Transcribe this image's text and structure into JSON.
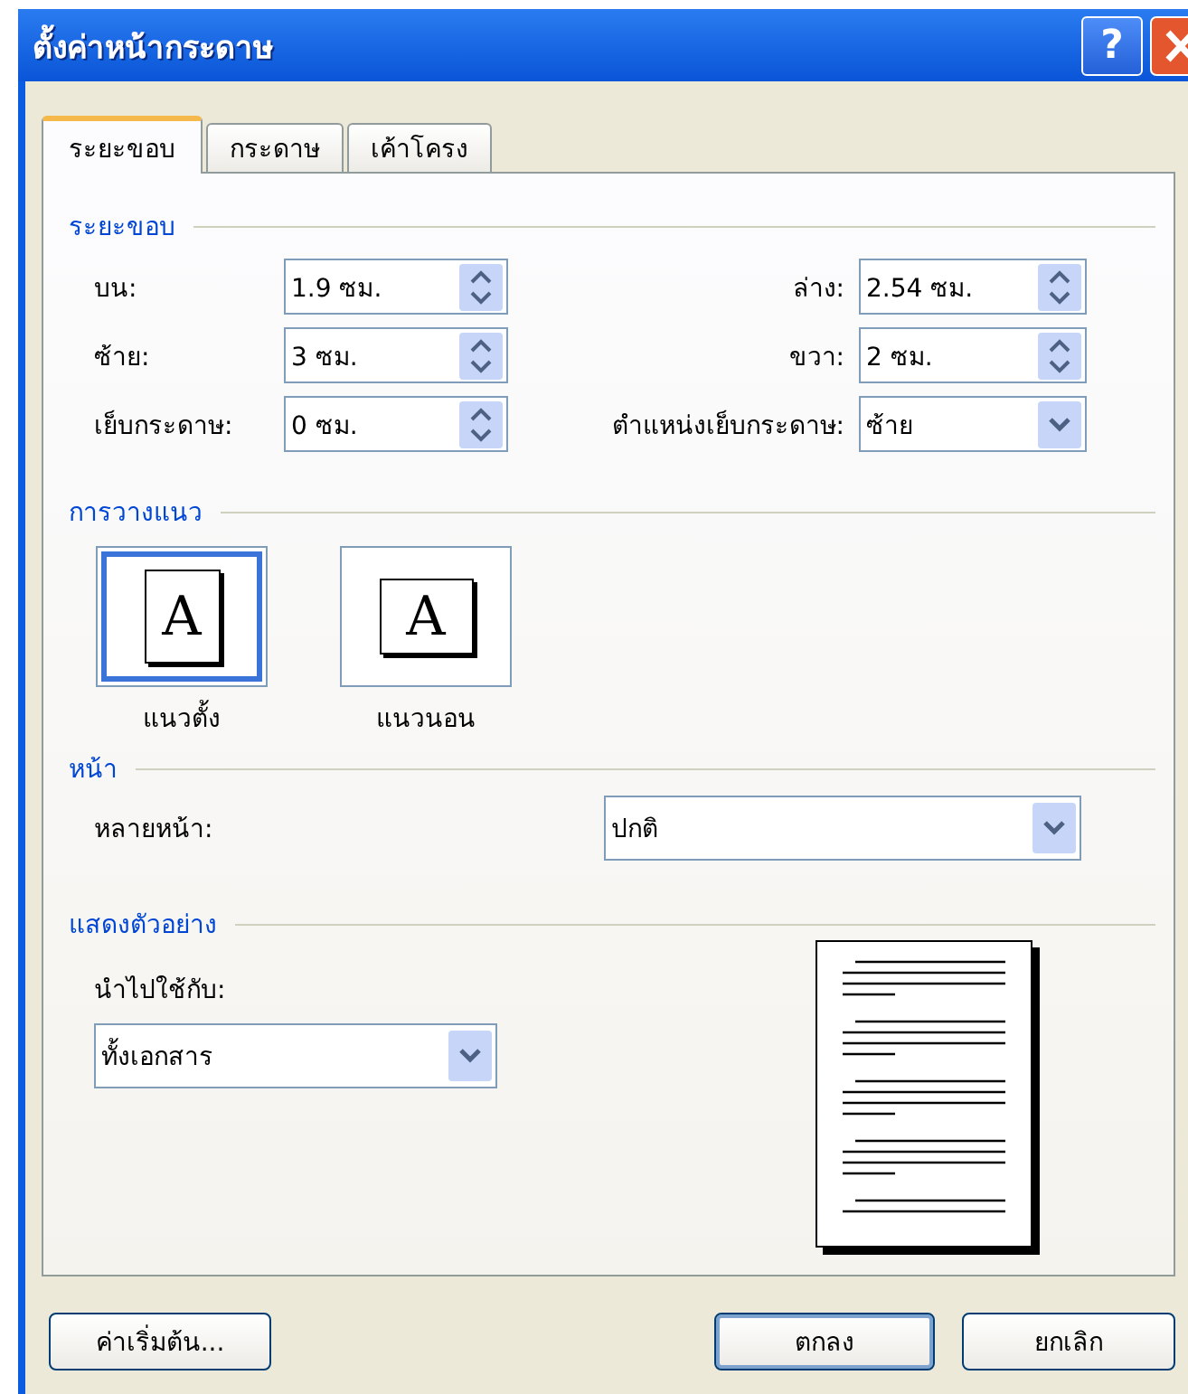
{
  "window": {
    "title": "ตั้งค่าหน้ากระดาษ",
    "help": "?"
  },
  "tabs": [
    {
      "label": "ระยะขอบ",
      "selected": true
    },
    {
      "label": "กระดาษ",
      "selected": false
    },
    {
      "label": "เค้าโครง",
      "selected": false
    }
  ],
  "margins": {
    "heading": "ระยะขอบ",
    "fields": [
      {
        "label": "บน:",
        "value": "1.9 ซม.",
        "kind": "spin"
      },
      {
        "label": "ล่าง:",
        "value": "2.54 ซม.",
        "kind": "spin"
      },
      {
        "label": "ซ้าย:",
        "value": "3 ซม.",
        "kind": "spin"
      },
      {
        "label": "ขวา:",
        "value": "2 ซม.",
        "kind": "spin"
      },
      {
        "label": "เย็บกระดาษ:",
        "value": "0 ซม.",
        "kind": "spin"
      },
      {
        "label": "ตำแหน่งเย็บกระดาษ:",
        "value": "ซ้าย",
        "kind": "dropdown"
      }
    ]
  },
  "orientation": {
    "heading": "การวางแนว",
    "options": [
      {
        "label": "แนวตั้ง",
        "glyph": "A",
        "kind": "portrait",
        "selected": true
      },
      {
        "label": "แนวนอน",
        "glyph": "A",
        "kind": "landscape",
        "selected": false
      }
    ]
  },
  "pages": {
    "heading": "หน้า",
    "label": "หลายหน้า:",
    "value": "ปกติ"
  },
  "preview": {
    "heading": "แสดงตัวอย่าง",
    "label": "นำไปใช้กับ:",
    "value": "ทั้งเอกสาร"
  },
  "buttons": [
    {
      "label": "ค่าเริ่มต้น...",
      "default": false
    },
    {
      "label": "ตกลง",
      "default": true
    },
    {
      "label": "ยกเลิก",
      "default": false
    }
  ]
}
